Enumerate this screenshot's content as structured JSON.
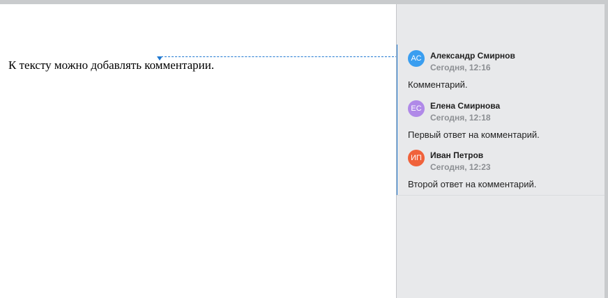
{
  "document": {
    "text": "К тексту можно добавлять комментарии."
  },
  "colors": {
    "accent": "#1f78d1",
    "panel_bg": "#e8e9eb"
  },
  "comments": [
    {
      "initials": "АС",
      "author": "Александр Смирнов",
      "time": "Сегодня, 12:16",
      "text": "Комментарий.",
      "avatar_color": "#3a9ef0"
    },
    {
      "initials": "ЕС",
      "author": "Елена Смирнова",
      "time": "Сегодня, 12:18",
      "text": "Первый ответ на комментарий.",
      "avatar_color": "#b089e8"
    },
    {
      "initials": "ИП",
      "author": "Иван Петров",
      "time": "Сегодня, 12:23",
      "text": "Второй ответ на комментарий.",
      "avatar_color": "#f0623b"
    }
  ]
}
